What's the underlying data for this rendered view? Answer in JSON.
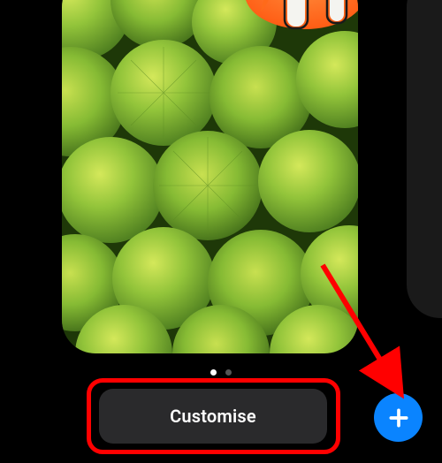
{
  "buttons": {
    "customise_label": "Customise"
  },
  "pager": {
    "count": 2,
    "active_index": 0
  },
  "colors": {
    "accent": "#0a84ff",
    "annotation": "#ff0000"
  },
  "icons": {
    "add": "plus-icon",
    "wallpaper": "clownfish-anemone"
  }
}
